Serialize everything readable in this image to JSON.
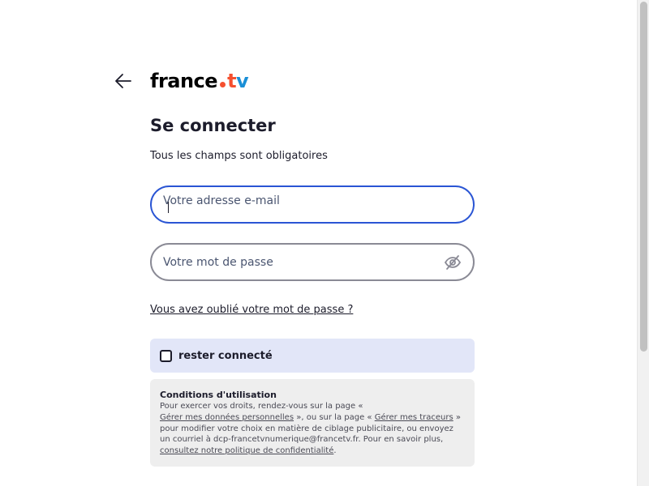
{
  "header": {
    "back_icon": "arrow-left-icon",
    "logo": {
      "word": "france",
      "tv_t": "t",
      "tv_v": "v",
      "dot_color": "#f5502f",
      "t_color": "#f5502f",
      "v_color": "#1a8fd6"
    }
  },
  "form": {
    "title": "Se connecter",
    "subtitle": "Tous les champs sont obligatoires",
    "email": {
      "value": "",
      "placeholder": "Votre adresse e-mail",
      "focused": true
    },
    "password": {
      "value": "",
      "placeholder": "Votre mot de passe",
      "toggle_icon": "eye-slash-icon"
    },
    "forgot_link": "Vous avez oublié votre mot de passe ?",
    "remember": {
      "label": "rester connecté",
      "checked": false
    }
  },
  "conditions": {
    "title": "Conditions d'utilisation",
    "text_1": "Pour exercer vos droits, rendez-vous sur la page «",
    "link_1": "Gérer mes données personnelles",
    "text_2": " », ou sur la page « ",
    "link_2": "Gérer mes traceurs",
    "text_3": " » pour modifier votre choix en matière de ciblage publicitaire, ou envoyez un courriel à dcp-francetvnumerique@francetv.fr. Pour en savoir plus, ",
    "link_3": "consultez notre politique de confidentialité",
    "text_4": "."
  },
  "colors": {
    "focus_border": "#2a55d4",
    "remember_bg": "#e2e6f8",
    "conditions_bg": "#eeeeee",
    "text": "#1c1c2b"
  }
}
